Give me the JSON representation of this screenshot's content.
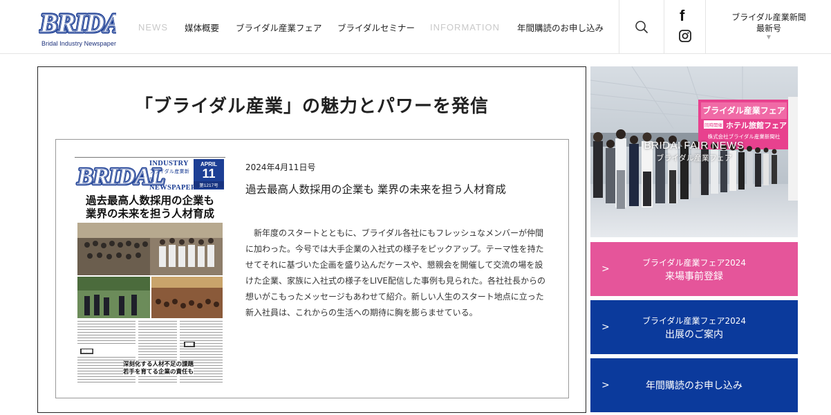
{
  "colors": {
    "brand_blue": "#1d3f95",
    "pink": "#e5559a",
    "navy": "#0b3a9c",
    "muted_nav": "#c9c9c9"
  },
  "header": {
    "logo_text": "BRIDAL",
    "logo_sub": "Bridal Industry Newspaper",
    "nav": [
      {
        "label": "NEWS",
        "muted": true
      },
      {
        "label": "媒体概要",
        "muted": false
      },
      {
        "label": "ブライダル産業フェア",
        "muted": false
      },
      {
        "label": "ブライダルセミナー",
        "muted": false
      },
      {
        "label": "INFORMATION",
        "muted": true
      },
      {
        "label": "年間購読のお申し込み",
        "muted": false
      }
    ],
    "search_icon": "search-icon",
    "facebook_icon": "facebook-icon",
    "instagram_icon": "instagram-icon",
    "latest_issue": {
      "line1": "ブライダル産業新聞",
      "line2": "最新号",
      "icon": "chevron-down-icon"
    }
  },
  "main": {
    "headline": "「ブライダル産業」の魅力とパワーを発信",
    "cover": {
      "logo": "BRIDAL",
      "masthead_line1": "INDUSTRY",
      "masthead_line2": "ブライダル産業新聞",
      "masthead_line3": "NEWSPAPER",
      "month": "APRIL",
      "day": "11",
      "issue_no": "第1217号",
      "title_line1": "過去最高人数採用の企業も",
      "title_line2": "業界の未来を担う人材育成",
      "sub_head_line1": "深刻化する人材不足の課題",
      "sub_head_line2": "若手を育てる企業の責任も"
    },
    "issue_date": "2024年4月11日号",
    "article_title": "過去最高人数採用の企業も 業界の未来を担う人材育成",
    "article_body": "新年度のスタートとともに、ブライダル各社にもフレッシュなメンバーが仲間に加わった。今号では大手企業の入社式の様子をピックアップ。テーマ性を持たせてそれに基づいた企画を盛り込んだケースや、懇親会を開催して交流の場を設けた企業、家族に入社式の様子をLIVE配信した事例も見られた。各社社長からの想いがこもったメッセージもあわせて紹介。新しい人生のスタート地点に立った新入社員は、これからの生活への期待に胸を膨らませている。"
  },
  "sidebar": {
    "fair_photo": {
      "caption_en": "BRIDAI FAIR NEWS",
      "caption_ja": "ブライダル産業フェア",
      "banner_line1": "ブライダル産業フェア",
      "banner_line2": "ホテル旅館フェア",
      "banner_small": "同時開催",
      "banner_org": "株式会社ブライダル産業新聞社"
    },
    "buttons": [
      {
        "line1": "ブライダル産業フェア2024",
        "line2": "来場事前登録",
        "color": "#e5559a",
        "icon": "chevron-right-icon"
      },
      {
        "line1": "ブライダル産業フェア2024",
        "line2": "出展のご案内",
        "color": "#0b3a9c",
        "icon": "chevron-right-icon"
      },
      {
        "line1": "年間購読のお申し込み",
        "color": "#0b3a9c",
        "icon": "chevron-right-icon"
      }
    ]
  }
}
